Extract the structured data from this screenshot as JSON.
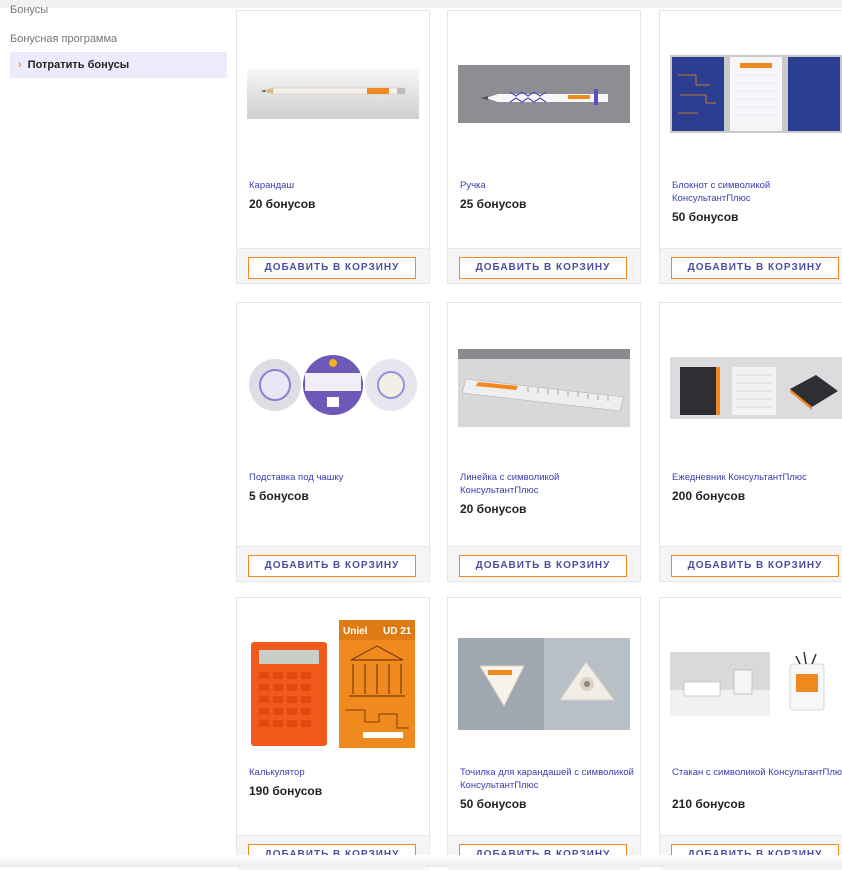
{
  "sidebar": {
    "items": [
      {
        "label": "Бонусы"
      },
      {
        "label": "Бонусная программа"
      },
      {
        "label": "Потратить бонусы",
        "active": true
      }
    ],
    "active_marker": "›"
  },
  "products": [
    {
      "name": "Карандаш",
      "price": "20 бонусов",
      "button": "ДОБАВИТЬ В КОРЗИНУ",
      "icon": "pencil-image"
    },
    {
      "name": "Ручка",
      "price": "25 бонусов",
      "button": "ДОБАВИТЬ В КОРЗИНУ",
      "icon": "pen-image"
    },
    {
      "name": "Блокнот с символикой КонсультантПлюс",
      "price": "50 бонусов",
      "button": "ДОБАВИТЬ В КОРЗИНУ",
      "icon": "notebook-image"
    },
    {
      "name": "Подставка под чашку",
      "price": "5 бонусов",
      "button": "ДОБАВИТЬ В КОРЗИНУ",
      "icon": "coaster-image"
    },
    {
      "name": "Линейка с символикой КонсультантПлюс",
      "price": "20 бонусов",
      "button": "ДОБАВИТЬ В КОРЗИНУ",
      "icon": "ruler-image"
    },
    {
      "name": "Ежедневник КонсультантПлюс",
      "price": "200 бонусов",
      "button": "ДОБАВИТЬ В КОРЗИНУ",
      "icon": "planner-image"
    },
    {
      "name": "Калькулятор",
      "price": "190 бонусов",
      "button": "ДОБАВИТЬ В КОРЗИНУ",
      "icon": "calculator-image",
      "brand_text": "Uniel",
      "model_text": "UD 21"
    },
    {
      "name": "Точилка для карандашей с символикой КонсультантПлюс",
      "price": "50 бонусов",
      "button": "ДОБАВИТЬ В КОРЗИНУ",
      "icon": "sharpener-image"
    },
    {
      "name": "Стакан с символикой КонсультантПлюс",
      "price": "210 бонусов",
      "button": "ДОБАВИТЬ В КОРЗИНУ",
      "icon": "pen-cup-image"
    }
  ],
  "colors": {
    "accent_orange": "#f08a1e",
    "link_purple": "#3b3db0",
    "button_text": "#4b4ea0",
    "active_bg": "#ecebfb"
  }
}
